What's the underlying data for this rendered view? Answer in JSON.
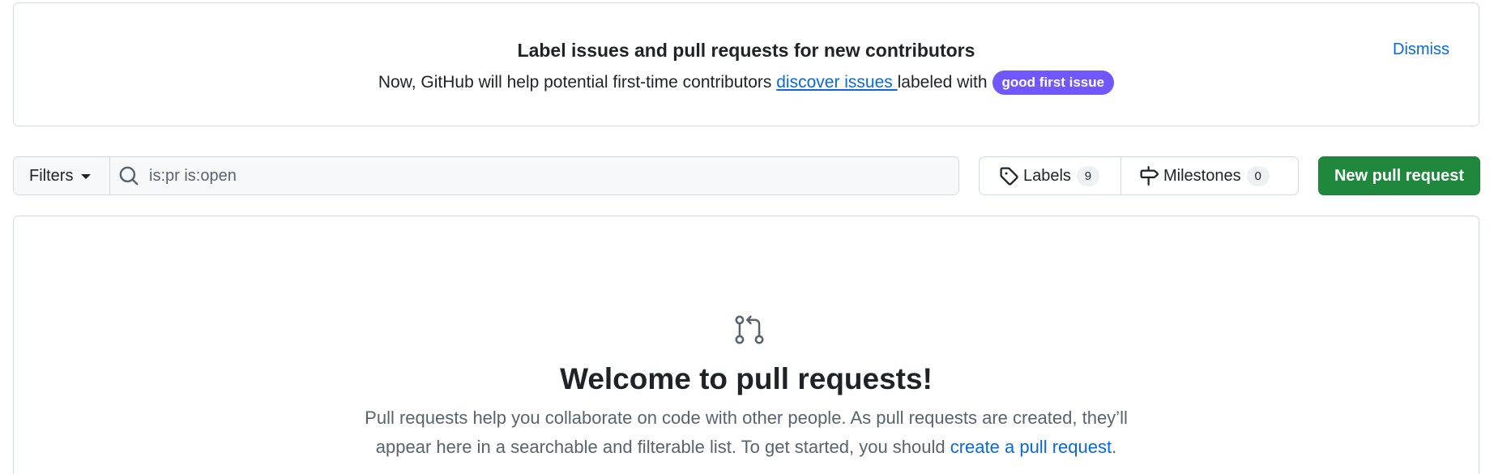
{
  "banner": {
    "title": "Label issues and pull requests for new contributors",
    "text_before": "Now, GitHub will help potential first-time contributors ",
    "link_text": "discover issues ",
    "text_after": "labeled with",
    "label": "good first issue",
    "dismiss": "Dismiss"
  },
  "toolbar": {
    "filters_label": "Filters",
    "search_value": "is:pr is:open",
    "labels_label": "Labels",
    "labels_count": "9",
    "milestones_label": "Milestones",
    "milestones_count": "0",
    "new_pr_label": "New pull request"
  },
  "blankslate": {
    "title": "Welcome to pull requests!",
    "line1": "Pull requests help you collaborate on code with other people. As pull requests are created, they’ll",
    "line2_before": "appear here in a searchable and filterable list. To get started, you should ",
    "link": "create a pull request",
    "line2_after": "."
  },
  "icons": {
    "search": "search-icon",
    "tag": "tag-icon",
    "milestone": "milestone-icon",
    "pull_request": "git-pull-request-icon",
    "caret": "caret-down-icon"
  },
  "colors": {
    "primary_button": "#1f883d",
    "link": "#0969da",
    "good_first_issue": "#7057ff",
    "border": "#d1d9e0"
  }
}
